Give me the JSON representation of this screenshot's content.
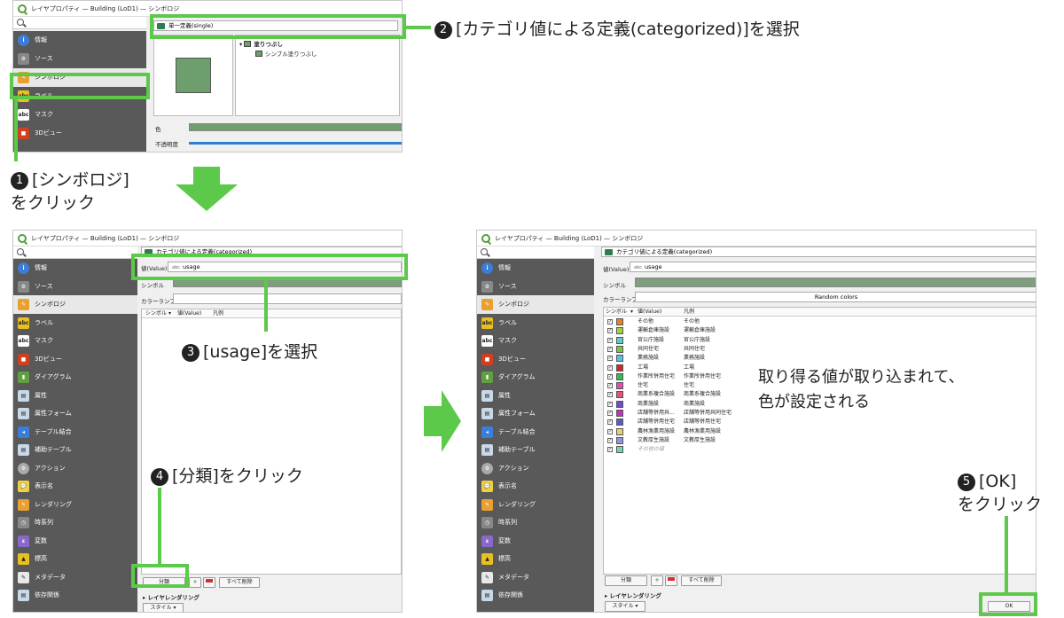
{
  "window_title": "レイヤプロパティ — Building (LoD1) — シンボロジ",
  "win1": {
    "renderer": "単一定義(single)",
    "tree_fill": "塗りつぶし",
    "tree_simple": "シンプル塗りつぶし",
    "color_label": "色",
    "opacity_label": "不透明度",
    "sidebar": [
      "情報",
      "ソース",
      "シンボロジ",
      "ラベル",
      "マスク",
      "3Dビュー"
    ]
  },
  "sidebar_full": [
    "情報",
    "ソース",
    "シンボロジ",
    "ラベル",
    "マスク",
    "3Dビュー",
    "ダイアグラム",
    "属性",
    "属性フォーム",
    "テーブル結合",
    "補助テーブル",
    "アクション",
    "表示名",
    "レンダリング",
    "時系列",
    "変数",
    "標高",
    "メタデータ",
    "依存関係"
  ],
  "win2": {
    "renderer": "カテゴリ値による定義(categorized)",
    "value_label": "値(Value)",
    "value_field": "usage",
    "symbol_label": "シンボル",
    "ramp_label": "カラーランプ",
    "col_symbol": "シンボル",
    "col_value": "値(Value)",
    "col_legend": "凡例",
    "classify_btn": "分類",
    "delete_all_btn": "すべて削除",
    "layer_rendering": "レイヤレンダリング",
    "style_btn": "スタイル"
  },
  "win3": {
    "renderer": "カテゴリ値による定義(categorized)",
    "value_label": "値(Value)",
    "value_field": "usage",
    "symbol_label": "シンボル",
    "ramp_label": "カラーランプ",
    "ramp_value": "Random colors",
    "col_symbol": "シンボル",
    "col_value": "値(Value)",
    "col_legend": "凡例",
    "classify_btn": "分類",
    "delete_all_btn": "すべて削除",
    "layer_rendering": "レイヤレンダリング",
    "style_btn": "スタイル",
    "ok_btn": "OK",
    "rows": [
      {
        "v": "その他",
        "l": "その他",
        "c": "#e8802a"
      },
      {
        "v": "運輸倉庫施設",
        "l": "運輸倉庫施設",
        "c": "#a8d03a"
      },
      {
        "v": "官公庁施設",
        "l": "官公庁施設",
        "c": "#5bd0c8"
      },
      {
        "v": "共同住宅",
        "l": "共同住宅",
        "c": "#7ac83a"
      },
      {
        "v": "業務施設",
        "l": "業務施設",
        "c": "#5ac0e8"
      },
      {
        "v": "工場",
        "l": "工場",
        "c": "#d02828"
      },
      {
        "v": "作業所併用住宅",
        "l": "作業所併用住宅",
        "c": "#3ab858"
      },
      {
        "v": "住宅",
        "l": "住宅",
        "c": "#e050a8"
      },
      {
        "v": "商業系複合施設",
        "l": "商業系複合施設",
        "c": "#e85080"
      },
      {
        "v": "商業施設",
        "l": "商業施設",
        "c": "#7848d0"
      },
      {
        "v": "店舗等併用共...",
        "l": "店舗等併用共同住宅",
        "c": "#c030c8"
      },
      {
        "v": "店舗等併用住宅",
        "l": "店舗等併用住宅",
        "c": "#6058c8"
      },
      {
        "v": "農林漁業用施設",
        "l": "農林漁業用施設",
        "c": "#e8d070"
      },
      {
        "v": "文教厚生施設",
        "l": "文教厚生施設",
        "c": "#8898e0"
      },
      {
        "v": "その他の値",
        "l": "",
        "c": "#70d8a8"
      }
    ]
  },
  "annotations": {
    "a1_num": "1",
    "a1_line1": "[シンボロジ]",
    "a1_line2": "をクリック",
    "a2_num": "2",
    "a2_text": "[カテゴリ値による定義(categorized)]を選択",
    "a3_num": "3",
    "a3_text": "[usage]を選択",
    "a4_num": "4",
    "a4_text": "[分類]をクリック",
    "a5_num": "5",
    "a5_line1": "[OK]",
    "a5_line2": "をクリック",
    "note_line1": "取り得る値が取り込まれて、",
    "note_line2": "色が設定される"
  },
  "colors": {
    "highlight": "#5dc94a",
    "arrow": "#5dc94a",
    "sidebar_bg": "#595959",
    "single_symbol": "#6e9e6e"
  }
}
